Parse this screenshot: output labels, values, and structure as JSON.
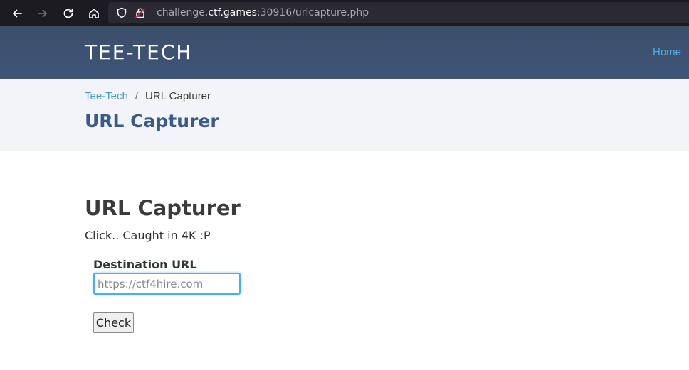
{
  "browser": {
    "url_prefix": "challenge.",
    "url_host": "ctf.games",
    "url_suffix": ":30916/urlcapture.php"
  },
  "header": {
    "brand": "TEE-TECH",
    "nav_home": "Home"
  },
  "title_band": {
    "breadcrumb_home": "Tee-Tech",
    "breadcrumb_sep": "/",
    "breadcrumb_current": "URL Capturer",
    "title": "URL Capturer"
  },
  "main": {
    "title": "URL Capturer",
    "tagline": "Click.. Caught in 4K :P",
    "field_label": "Destination URL",
    "input_placeholder": "https://ctf4hire.com",
    "input_value": "",
    "check_label": "Check"
  },
  "colors": {
    "header_bg": "#3f5578",
    "link": "#3aa0d6",
    "title_blue": "#3a5a8a",
    "focus_border": "#4aaef2"
  }
}
